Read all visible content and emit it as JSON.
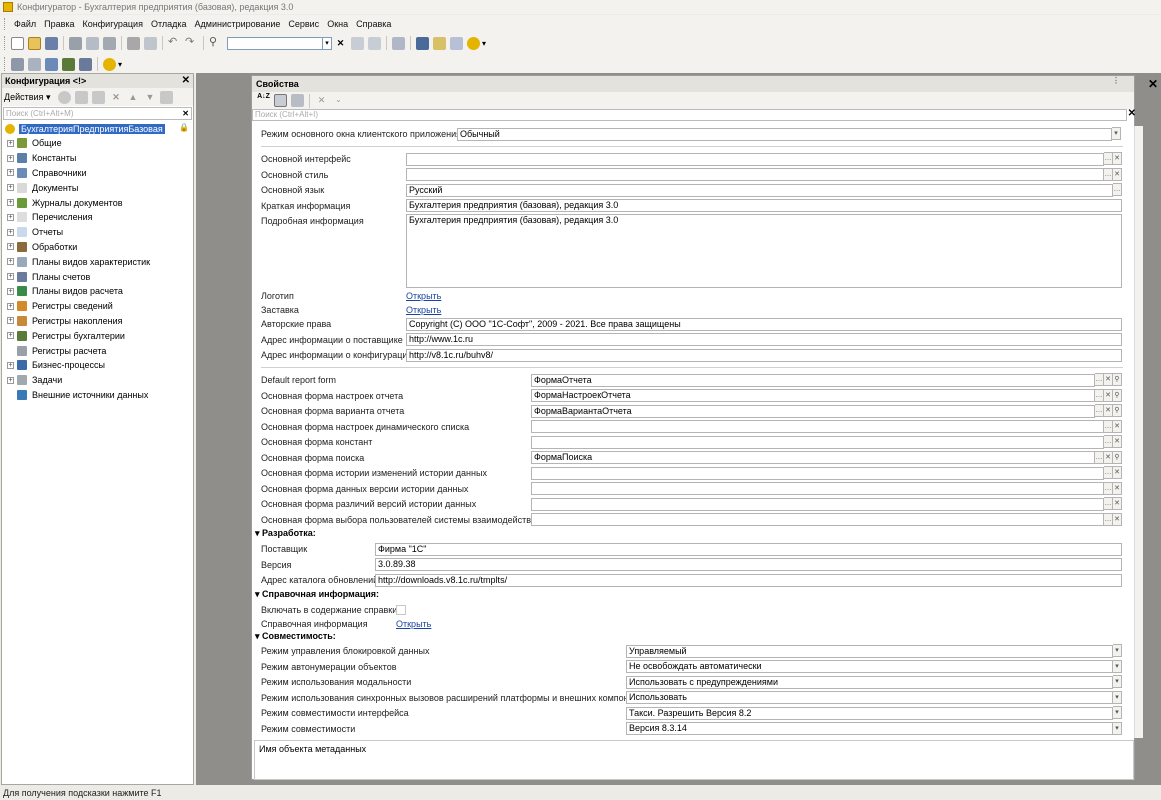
{
  "window": {
    "title": "Конфигуратор - Бухгалтерия предприятия (базовая), редакция 3.0"
  },
  "menu": [
    "Файл",
    "Правка",
    "Конфигурация",
    "Отладка",
    "Администрирование",
    "Сервис",
    "Окна",
    "Справка"
  ],
  "left_panel": {
    "title": "Конфигурация <!>",
    "actions_label": "Действия",
    "search_placeholder": "Поиск (Ctrl+Alt+M)",
    "root": "БухгалтерияПредприятияБазовая",
    "items": [
      {
        "label": "Общие",
        "icon": "common-icon",
        "color": "#7a9a3a"
      },
      {
        "label": "Константы",
        "icon": "constants-icon",
        "color": "#5b7fa8"
      },
      {
        "label": "Справочники",
        "icon": "catalogs-icon",
        "color": "#6b8cb8"
      },
      {
        "label": "Документы",
        "icon": "documents-icon",
        "color": "#d9d9d9"
      },
      {
        "label": "Журналы документов",
        "icon": "journals-icon",
        "color": "#6a9a3a"
      },
      {
        "label": "Перечисления",
        "icon": "enums-icon",
        "color": "#dddddd"
      },
      {
        "label": "Отчеты",
        "icon": "reports-icon",
        "color": "#c9d9e9"
      },
      {
        "label": "Обработки",
        "icon": "dataprocessors-icon",
        "color": "#8a6a3a"
      },
      {
        "label": "Планы видов характеристик",
        "icon": "chart-of-characteristics-icon",
        "color": "#9aa9b9"
      },
      {
        "label": "Планы счетов",
        "icon": "chart-of-accounts-icon",
        "color": "#6b7b9b"
      },
      {
        "label": "Планы видов расчета",
        "icon": "chart-of-calculation-icon",
        "color": "#3a8a4a"
      },
      {
        "label": "Регистры сведений",
        "icon": "info-registers-icon",
        "color": "#d28a2a"
      },
      {
        "label": "Регистры накопления",
        "icon": "accumulation-registers-icon",
        "color": "#c78a3a"
      },
      {
        "label": "Регистры бухгалтерии",
        "icon": "accounting-registers-icon",
        "color": "#5a7a3a"
      },
      {
        "label": "Регистры расчета",
        "icon": "calculation-registers-icon",
        "color": "#9aa0a8"
      },
      {
        "label": "Бизнес-процессы",
        "icon": "business-processes-icon",
        "color": "#3a6aa8"
      },
      {
        "label": "Задачи",
        "icon": "tasks-icon",
        "color": "#a0a8b0"
      },
      {
        "label": "Внешние источники данных",
        "icon": "external-sources-icon",
        "color": "#3a7ab8"
      }
    ]
  },
  "properties": {
    "title": "Свойства",
    "search_placeholder": "Поиск (Ctrl+Alt+I)",
    "main_window_mode": {
      "label": "Режим основного окна клиентского приложения",
      "value": "Обычный"
    },
    "base_fields": [
      {
        "label": "Основной интерфейс",
        "value": ""
      },
      {
        "label": "Основной стиль",
        "value": ""
      },
      {
        "label": "Основной язык",
        "value": "Русский"
      },
      {
        "label": "Краткая информация",
        "value": "Бухгалтерия предприятия (базовая), редакция 3.0"
      }
    ],
    "detailed_info": {
      "label": "Подробная информация",
      "value": "Бухгалтерия предприятия (базовая), редакция 3.0"
    },
    "logo": {
      "label": "Логотип",
      "link": "Открыть"
    },
    "splash": {
      "label": "Заставка",
      "link": "Открыть"
    },
    "info_fields": [
      {
        "label": "Авторские права",
        "value": "Copyright (C) ООО \"1С-Софт\", 2009 - 2021. Все права защищены"
      },
      {
        "label": "Адрес информации о поставщике",
        "value": "http://www.1c.ru"
      },
      {
        "label": "Адрес информации о конфигурации",
        "value": "http://v8.1c.ru/buhv8/"
      }
    ],
    "forms": [
      {
        "label": "Default report form",
        "value": "ФормаОтчета"
      },
      {
        "label": "Основная форма настроек отчета",
        "value": "ФормаНастроекОтчета"
      },
      {
        "label": "Основная форма варианта отчета",
        "value": "ФормаВариантаОтчета"
      },
      {
        "label": "Основная форма настроек динамического списка",
        "value": ""
      },
      {
        "label": "Основная форма констант",
        "value": ""
      },
      {
        "label": "Основная форма поиска",
        "value": "ФормаПоиска"
      },
      {
        "label": "Основная форма истории изменений истории данных",
        "value": ""
      },
      {
        "label": "Основная форма данных версии истории данных",
        "value": ""
      },
      {
        "label": "Основная форма различий версий истории данных",
        "value": ""
      },
      {
        "label": "Основная форма выбора пользователей системы взаимодействия",
        "value": ""
      }
    ],
    "development": {
      "title": "Разработка:",
      "fields": [
        {
          "label": "Поставщик",
          "value": "Фирма \"1С\""
        },
        {
          "label": "Версия",
          "value": "3.0.89.38"
        },
        {
          "label": "Адрес каталога обновлений",
          "value": "http://downloads.v8.1c.ru/tmplts/"
        }
      ]
    },
    "help": {
      "title": "Справочная информация:",
      "include_label": "Включать в содержание справки",
      "include_checked": false,
      "info_label": "Справочная информация",
      "info_link": "Открыть"
    },
    "compat": {
      "title": "Совместимость:",
      "fields": [
        {
          "label": "Режим управления блокировкой данных",
          "value": "Управляемый"
        },
        {
          "label": "Режим автонумерации объектов",
          "value": "Не освобождать автоматически"
        },
        {
          "label": "Режим использования модальности",
          "value": "Использовать с предупреждениями"
        },
        {
          "label": "Режим использования синхронных вызовов расширений платформы и внешних компонент",
          "value": "Использовать"
        },
        {
          "label": "Режим совместимости интерфейса",
          "value": "Такси. Разрешить Версия 8.2"
        },
        {
          "label": "Режим совместимости",
          "value": "Версия 8.3.14"
        }
      ]
    },
    "footer_text": "Имя объекта метаданных"
  },
  "status_bar": "Для получения подсказки нажмите F1"
}
